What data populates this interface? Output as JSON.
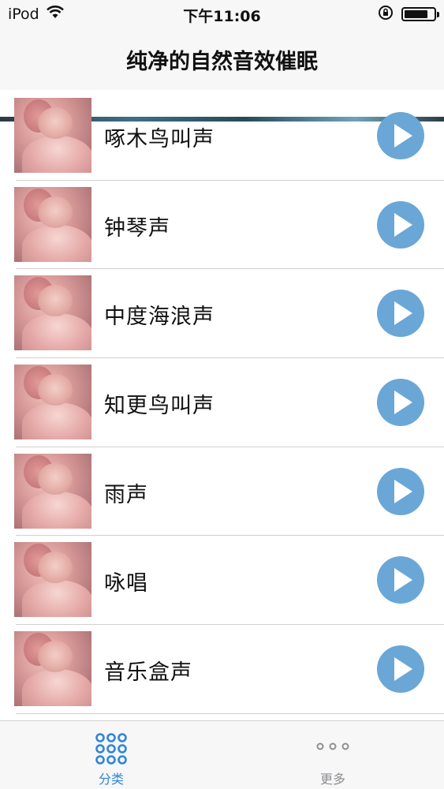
{
  "status_bar": {
    "carrier": "iPod",
    "time": "下午11:06",
    "wifi_icon": "wifi-icon",
    "rotation_lock_icon": "rotation-lock-icon",
    "battery_level": 0.8
  },
  "nav": {
    "title": "纯净的自然音效催眠"
  },
  "list": {
    "items": [
      {
        "label": "啄木鸟叫声"
      },
      {
        "label": "钟琴声"
      },
      {
        "label": "中度海浪声"
      },
      {
        "label": "知更鸟叫声"
      },
      {
        "label": "雨声"
      },
      {
        "label": "咏唱"
      },
      {
        "label": "音乐盒声"
      }
    ],
    "play_icon": "play-icon"
  },
  "tab_bar": {
    "tabs": [
      {
        "label": "分类",
        "icon": "grid-dots-icon",
        "selected": true
      },
      {
        "label": "更多",
        "icon": "more-dots-icon",
        "selected": false
      }
    ],
    "active_color": "#2f86d8",
    "inactive_color": "#8e8e93"
  },
  "colors": {
    "play_button": "#6aa7d6",
    "bar_background": "#f7f7f7"
  }
}
